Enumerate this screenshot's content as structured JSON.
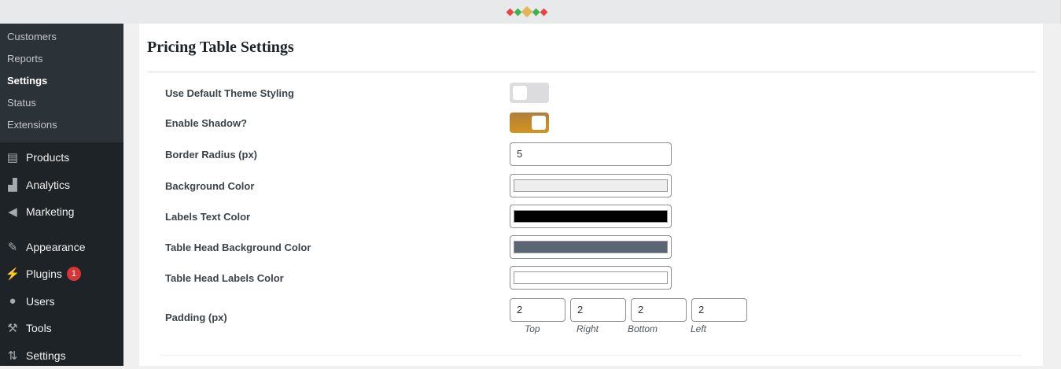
{
  "sidebar": {
    "submenu": [
      "Customers",
      "Reports",
      "Settings",
      "Status",
      "Extensions"
    ],
    "active_submenu": "Settings",
    "menu": [
      {
        "label": "Products",
        "icon": "archive-icon"
      },
      {
        "label": "Analytics",
        "icon": "bar-chart-icon"
      },
      {
        "label": "Marketing",
        "icon": "megaphone-icon"
      },
      {
        "label": "Appearance",
        "icon": "paintbrush-icon"
      },
      {
        "label": "Plugins",
        "icon": "plugin-icon",
        "badge": "1"
      },
      {
        "label": "Users",
        "icon": "user-icon"
      },
      {
        "label": "Tools",
        "icon": "wrench-icon"
      },
      {
        "label": "Settings",
        "icon": "sliders-icon"
      }
    ]
  },
  "page": {
    "title": "Pricing Table Settings",
    "fields": {
      "default_styling": {
        "label": "Use Default Theme Styling",
        "value": false
      },
      "shadow": {
        "label": "Enable Shadow?",
        "value": true
      },
      "border_radius": {
        "label": "Border Radius (px)",
        "value": "5"
      },
      "bg_color": {
        "label": "Background Color",
        "value": "#eeeeee"
      },
      "labels_color": {
        "label": "Labels Text Color",
        "value": "#000000"
      },
      "head_bg": {
        "label": "Table Head Background Color",
        "value": "#5b6674"
      },
      "head_labels": {
        "label": "Table Head Labels Color",
        "value": "#ffffff"
      },
      "padding": {
        "label": "Padding (px)",
        "top": "2",
        "right": "2",
        "bottom": "2",
        "left": "2",
        "top_label": "Top",
        "right_label": "Right",
        "bottom_label": "Bottom",
        "left_label": "Left"
      }
    }
  },
  "colors": {
    "accent": "#d4941f",
    "sidebar": "#1d2327",
    "submenu": "#2c3338",
    "badge": "#d63638"
  }
}
